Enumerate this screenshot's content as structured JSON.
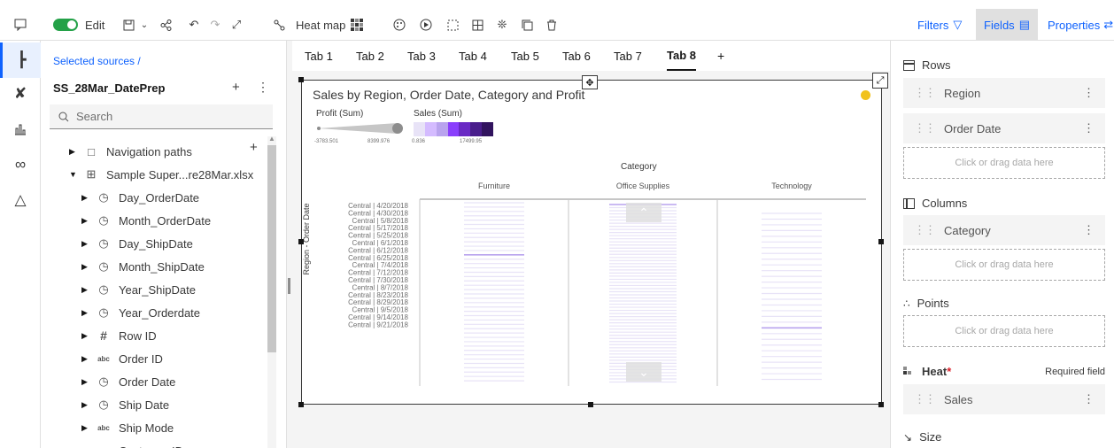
{
  "toolbar": {
    "edit_label": "Edit",
    "heatmap_label": "Heat map",
    "filters_label": "Filters",
    "fields_label": "Fields",
    "properties_label": "Properties"
  },
  "sources": {
    "header": "Selected sources /",
    "name": "SS_28Mar_DatePrep",
    "search_placeholder": "Search",
    "items": [
      {
        "label": "Navigation paths",
        "icon": "folder-icon"
      },
      {
        "label": "Sample Super...re28Mar.xlsx",
        "icon": "table-icon"
      },
      {
        "label": "Day_OrderDate",
        "icon": "clock-icon"
      },
      {
        "label": "Month_OrderDate",
        "icon": "clock-icon"
      },
      {
        "label": "Day_ShipDate",
        "icon": "clock-icon"
      },
      {
        "label": "Month_ShipDate",
        "icon": "clock-icon"
      },
      {
        "label": "Year_ShipDate",
        "icon": "clock-icon"
      },
      {
        "label": "Year_Orderdate",
        "icon": "clock-icon"
      },
      {
        "label": "Row ID",
        "icon": "hash-icon"
      },
      {
        "label": "Order ID",
        "icon": "abc-icon"
      },
      {
        "label": "Order Date",
        "icon": "clock-icon"
      },
      {
        "label": "Ship Date",
        "icon": "clock-icon"
      },
      {
        "label": "Ship Mode",
        "icon": "abc-icon"
      },
      {
        "label": "Customer ID",
        "icon": "abc-icon"
      }
    ]
  },
  "tabs": [
    "Tab 1",
    "Tab 2",
    "Tab 3",
    "Tab 4",
    "Tab 5",
    "Tab 6",
    "Tab 7",
    "Tab 8"
  ],
  "active_tab": "Tab 8",
  "tab_add": "+",
  "viz": {
    "title": "Sales by Region, Order Date, Category and Profit",
    "legend_profit": {
      "label": "Profit (Sum)",
      "min": "-3783.501",
      "max": "8399.976"
    },
    "legend_sales": {
      "label": "Sales (Sum)",
      "min": "0.836",
      "max": "17499.95"
    },
    "category_label": "Category",
    "y_axis_label": "Region - Order Date",
    "colors": {
      "heat_light": "#e8e3f7",
      "heat_mid": "#b9a3ee",
      "heat_dark": "#6929c4",
      "heat_darkest": "#31135e"
    }
  },
  "chart_data": {
    "type": "heatmap",
    "title": "Sales by Region, Order Date, Category and Profit",
    "xlabel": "Category",
    "ylabel": "Region - Order Date",
    "categories": [
      "Furniture",
      "Office Supplies",
      "Technology"
    ],
    "rows": [
      "Central | 4/20/2018",
      "Central | 4/30/2018",
      "Central | 5/8/2018",
      "Central | 5/17/2018",
      "Central | 5/25/2018",
      "Central | 6/1/2018",
      "Central | 6/12/2018",
      "Central | 6/25/2018",
      "Central | 7/4/2018",
      "Central | 7/12/2018",
      "Central | 7/30/2018",
      "Central | 8/7/2018",
      "Central | 8/23/2018",
      "Central | 8/29/2018",
      "Central | 9/5/2018",
      "Central | 9/14/2018",
      "Central | 9/21/2018"
    ],
    "sales_range": [
      0.836,
      17499.95
    ],
    "profit_range": [
      -3783.501,
      8399.976
    ]
  },
  "fields": {
    "rows_label": "Rows",
    "rows_items": [
      "Region",
      "Order Date"
    ],
    "columns_label": "Columns",
    "columns_items": [
      "Category"
    ],
    "points_label": "Points",
    "heat_label": "Heat",
    "heat_required_mark": "*",
    "required_text": "Required field",
    "heat_items": [
      "Sales"
    ],
    "size_label": "Size",
    "drop_hint": "Click or drag data here"
  }
}
